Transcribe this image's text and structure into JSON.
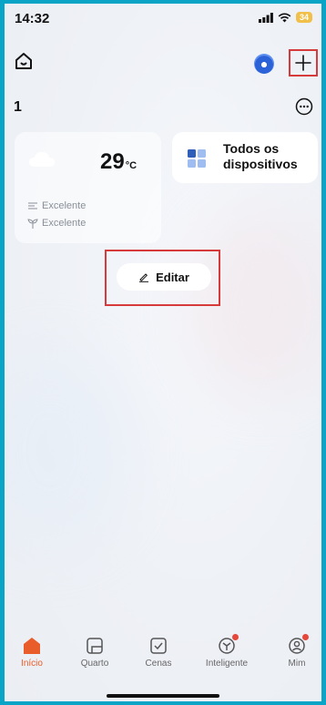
{
  "status_bar": {
    "time": "14:32",
    "battery": "34"
  },
  "header": {
    "home_icon": "home-icon",
    "robot_icon": "robot-icon",
    "add_icon": "plus-icon"
  },
  "home": {
    "name": "1"
  },
  "weather_card": {
    "temperature": "29",
    "unit": "°C",
    "metrics": [
      {
        "icon": "air-quality-icon",
        "label": "Excelente"
      },
      {
        "icon": "plant-icon",
        "label": "Excelente"
      }
    ]
  },
  "devices_card": {
    "label": "Todos os dispositivos"
  },
  "edit_button": {
    "label": "Editar"
  },
  "tabs": [
    {
      "label": "Início",
      "icon": "home-tab-icon",
      "active": true
    },
    {
      "label": "Quarto",
      "icon": "room-icon",
      "active": false
    },
    {
      "label": "Cenas",
      "icon": "scenes-icon",
      "active": false
    },
    {
      "label": "Inteligente",
      "icon": "smart-icon",
      "active": false,
      "badge": true
    },
    {
      "label": "Mim",
      "icon": "profile-icon",
      "active": false,
      "badge": true
    }
  ],
  "colors": {
    "accent": "#e85d2a",
    "highlight": "#d63a3a",
    "frame": "#0aa4c6"
  }
}
